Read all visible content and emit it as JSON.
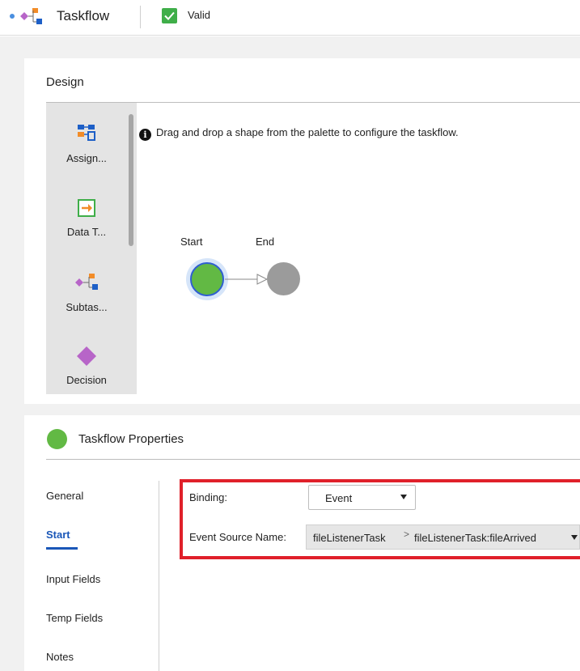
{
  "header": {
    "title": "Taskflow",
    "status_label": "Valid",
    "colors": {
      "valid": "#3fae49"
    }
  },
  "design": {
    "title": "Design",
    "palette": [
      {
        "label": "Assign...",
        "icon": "assignment-icon"
      },
      {
        "label": "Data T...",
        "icon": "data-task-icon"
      },
      {
        "label": "Subtas...",
        "icon": "subtaskflow-icon"
      },
      {
        "label": "Decision",
        "icon": "decision-icon"
      }
    ],
    "info_message": "Drag and drop a shape from the palette to configure the taskflow.",
    "nodes": {
      "start_label": "Start",
      "end_label": "End"
    }
  },
  "properties": {
    "title": "Taskflow Properties",
    "nav": [
      {
        "label": "General"
      },
      {
        "label": "Start"
      },
      {
        "label": "Input Fields"
      },
      {
        "label": "Temp Fields"
      },
      {
        "label": "Notes"
      }
    ],
    "active_nav": "Start",
    "binding": {
      "label": "Binding:",
      "value": "Event"
    },
    "event_source": {
      "label": "Event Source Name:",
      "segment1": "fileListenerTask",
      "separator": ">",
      "segment2": "fileListenerTask:fileArrived"
    }
  }
}
